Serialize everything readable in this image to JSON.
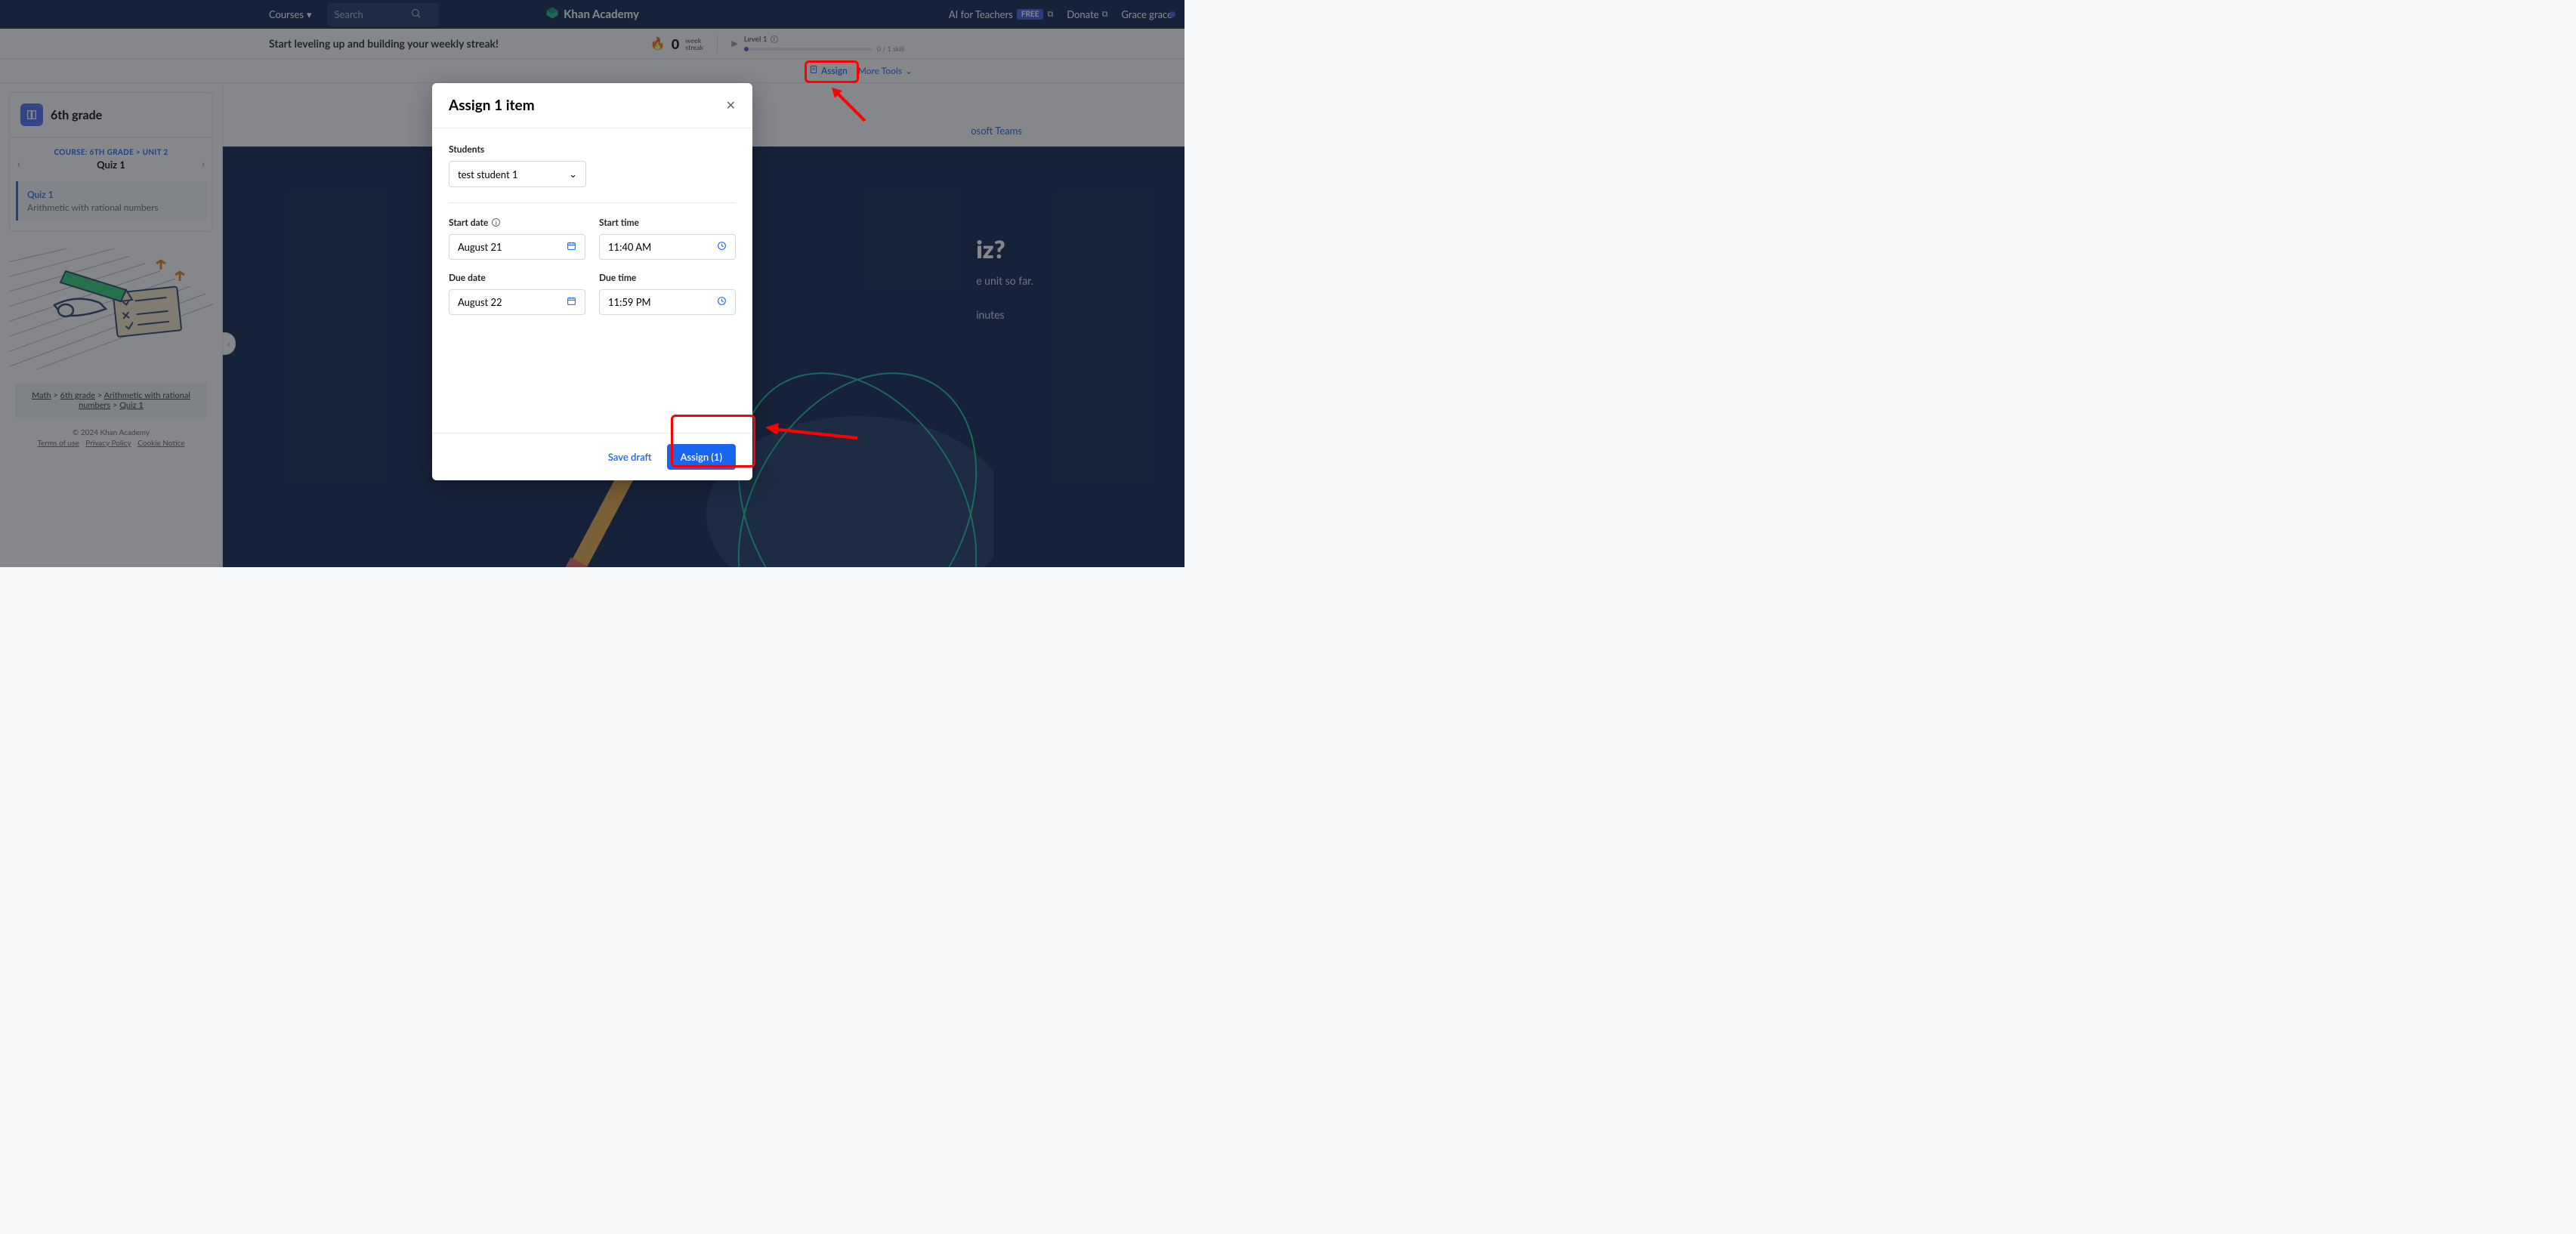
{
  "topnav": {
    "courses": "Courses",
    "search_placeholder": "Search",
    "brand": "Khan Academy",
    "ai_teachers": "AI for Teachers",
    "free": "FREE",
    "donate": "Donate",
    "user": "Grace grace"
  },
  "streak": {
    "headline": "Start leveling up and building your weekly streak!",
    "count": "0",
    "week": "week",
    "streak_label": "streak",
    "level": "Level 1",
    "skill": "0 / 1 skill"
  },
  "tools": {
    "assign": "Assign",
    "more": "More Tools"
  },
  "sidebar": {
    "grade": "6th grade",
    "crumb": "COURSE: 6TH GRADE  >  UNIT 2",
    "quiz_head": "Quiz 1",
    "quiz_title": "Quiz 1",
    "quiz_desc": "Arithmetic with rational numbers",
    "bc": {
      "math": "Math",
      "grade": "6th grade",
      "unit": "Arithmetic with rational numbers",
      "quiz": "Quiz 1"
    },
    "copyright": "© 2024 Khan Academy",
    "terms": "Terms of use",
    "privacy": "Privacy Policy",
    "cookie": "Cookie Notice"
  },
  "content": {
    "teams": "osoft Teams",
    "hero_h": "iz?",
    "hero_s1": "e unit so far.",
    "hero_s2": "inutes"
  },
  "modal": {
    "title": "Assign 1 item",
    "students_label": "Students",
    "students_value": "test student 1",
    "start_date_label": "Start date",
    "start_date_value": "August 21",
    "start_time_label": "Start time",
    "start_time_value": "11:40 AM",
    "due_date_label": "Due date",
    "due_date_value": "August 22",
    "due_time_label": "Due time",
    "due_time_value": "11:59 PM",
    "save_draft": "Save draft",
    "assign_btn": "Assign (1)"
  }
}
